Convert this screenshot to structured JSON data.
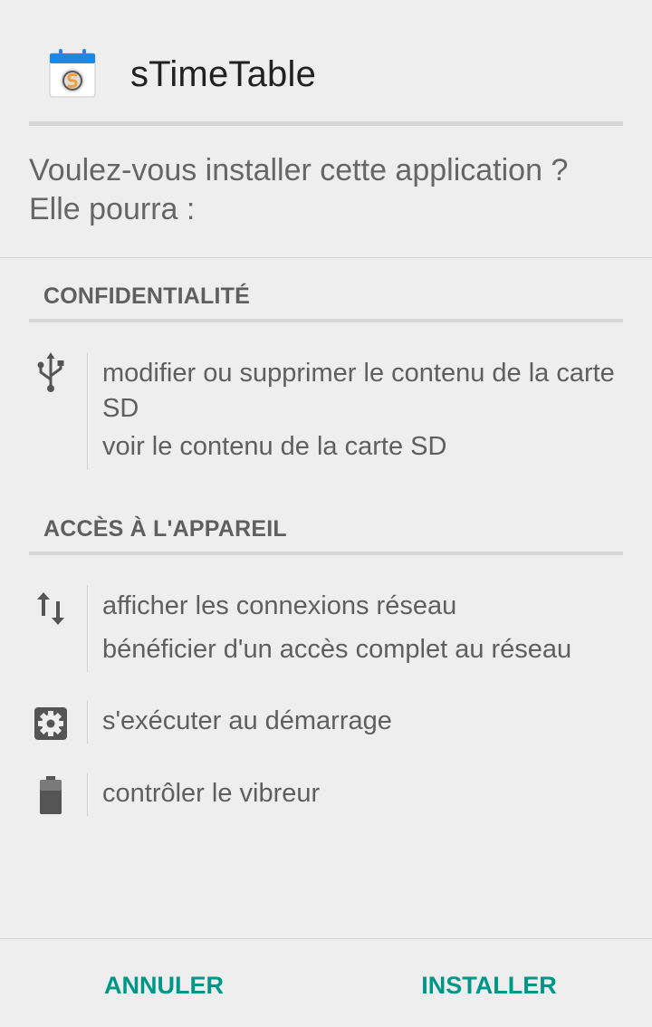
{
  "app": {
    "title": "sTimeTable",
    "icon": "calendar-app-icon"
  },
  "question": {
    "line1": "Voulez-vous installer cette application ?",
    "line2": "Elle pourra :"
  },
  "sections": [
    {
      "title": "CONFIDENTIALITÉ",
      "groups": [
        {
          "icon": "usb-icon",
          "items": [
            "modifier ou supprimer le contenu de la carte SD",
            "voir le contenu de la carte SD"
          ]
        }
      ]
    },
    {
      "title": "ACCÈS À L'APPAREIL",
      "groups": [
        {
          "icon": "network-arrows-icon",
          "items": [
            "afficher les connexions réseau",
            "bénéficier d'un accès complet au réseau"
          ]
        },
        {
          "icon": "gear-icon",
          "items": [
            "s'exécuter au démarrage"
          ]
        },
        {
          "icon": "battery-icon",
          "items": [
            "contrôler le vibreur"
          ]
        }
      ]
    }
  ],
  "buttons": {
    "cancel": "ANNULER",
    "install": "INSTALLER"
  },
  "colors": {
    "accent": "#009688",
    "background": "#eeeeee",
    "icon_blue": "#1e88e5"
  }
}
